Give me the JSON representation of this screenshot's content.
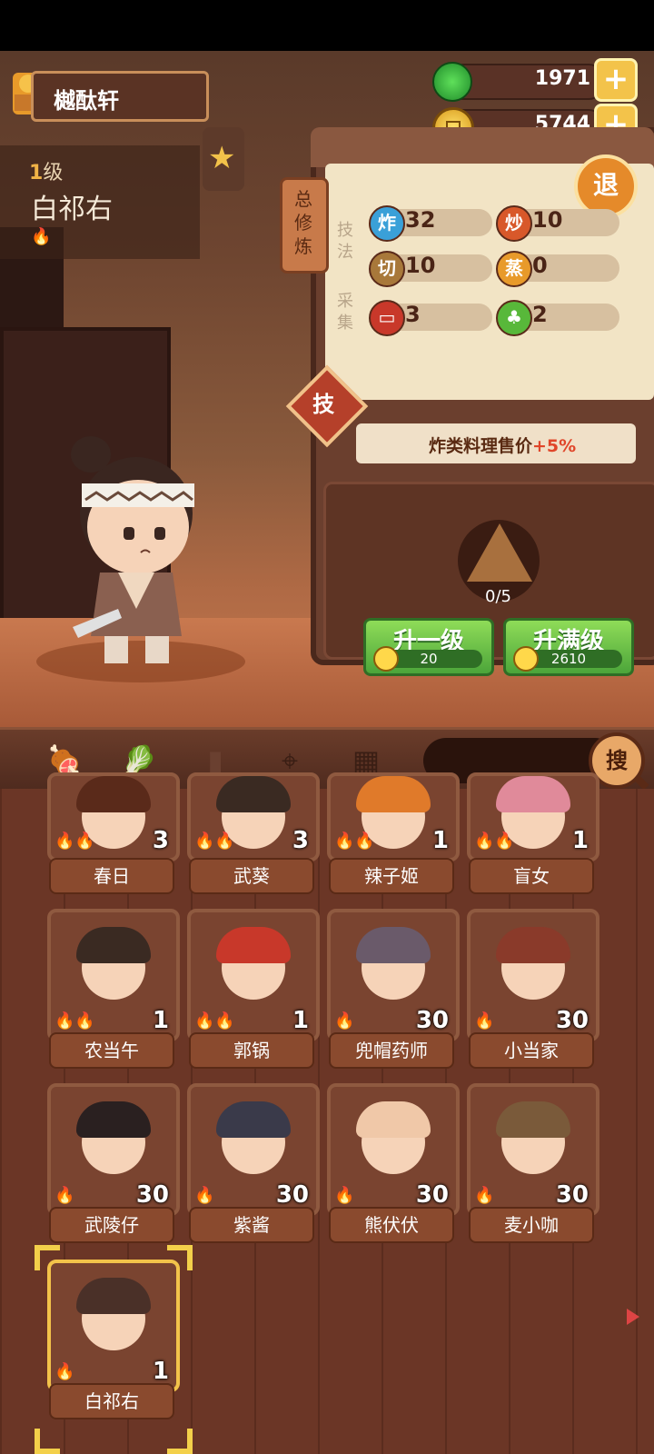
{
  "header": {
    "shop_name": "樾酞轩",
    "level_num": "1",
    "level_suffix": "级",
    "hero_name": "白祁右"
  },
  "currency": {
    "jade": "1971",
    "coins": "5744",
    "plus": "+"
  },
  "panel": {
    "tag": "总修炼",
    "exit": "退",
    "skills_label": "技法",
    "gather_label": "采集",
    "stats": [
      {
        "icon": "炸",
        "value": "32",
        "color": "#3aa0d8"
      },
      {
        "icon": "炒",
        "value": "10",
        "color": "#d8582a"
      },
      {
        "icon": "切",
        "value": "10",
        "color": "#a8783a"
      },
      {
        "icon": "蒸",
        "value": "0",
        "color": "#e89a2a"
      },
      {
        "icon": "",
        "value": "3",
        "color": "#c8382a"
      },
      {
        "icon": "",
        "value": "2",
        "color": "#58b83a"
      }
    ],
    "skill_badge": "技",
    "bonus_text": "炸类料理售价",
    "bonus_value": "+5%",
    "progress": "0/5",
    "upgrade_one": {
      "label": "升一级",
      "cost": "20"
    },
    "upgrade_max": {
      "label": "升满级",
      "cost": "2610"
    }
  },
  "filters": {
    "icons": [
      "meat-filter-icon",
      "vegetable-filter-icon",
      "jar-filter-icon",
      "location-filter-icon",
      "map-filter-icon"
    ],
    "search_label": "搜"
  },
  "characters": [
    {
      "name": "春日",
      "level": "3",
      "flames": "🔥🔥",
      "hair": "#5a2a1a"
    },
    {
      "name": "武葵",
      "level": "3",
      "flames": "🔥🔥",
      "hair": "#3a2a22"
    },
    {
      "name": "辣子姬",
      "level": "1",
      "flames": "🔥🔥",
      "hair": "#e07a2a"
    },
    {
      "name": "盲女",
      "level": "1",
      "flames": "🔥🔥",
      "hair": "#e08a9a"
    },
    {
      "name": "农当午",
      "level": "1",
      "flames": "🔥🔥",
      "hair": "#3a2a22"
    },
    {
      "name": "郭锅",
      "level": "1",
      "flames": "🔥🔥",
      "hair": "#c8382a"
    },
    {
      "name": "兜帽药师",
      "level": "30",
      "flames": "🔥",
      "hair": "#6a5a6a"
    },
    {
      "name": "小当家",
      "level": "30",
      "flames": "🔥",
      "hair": "#8a3a2a"
    },
    {
      "name": "武陵仔",
      "level": "30",
      "flames": "🔥",
      "hair": "#2a2020"
    },
    {
      "name": "紫酱",
      "level": "30",
      "flames": "🔥",
      "hair": "#3a3a4a"
    },
    {
      "name": "熊伏伏",
      "level": "30",
      "flames": "🔥",
      "hair": "#f0c8a8"
    },
    {
      "name": "麦小咖",
      "level": "30",
      "flames": "🔥",
      "hair": "#7a5a3a"
    },
    {
      "name": "白祁右",
      "level": "1",
      "flames": "🔥",
      "hair": "#4a3028"
    }
  ]
}
